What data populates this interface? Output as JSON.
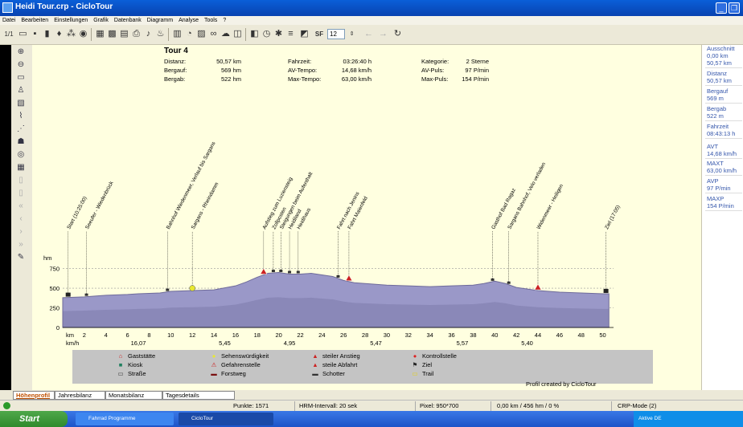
{
  "window": {
    "title": "Heidi Tour.crp - CicloTour"
  },
  "menu": [
    "Datei",
    "Bearbeiten",
    "Einstellungen",
    "Grafik",
    "Datenbank",
    "Diagramm",
    "Analyse",
    "Tools",
    "?"
  ],
  "toolbar": {
    "page_label": "1/1",
    "sf_label": "SF",
    "zoom_value": "12"
  },
  "tour": {
    "title": "Tour 4",
    "stats": [
      {
        "label": "Distanz:",
        "value": "50,57 km",
        "label2": "Fahrzeit:",
        "value2": "03:26:40 h",
        "label3": "Kategorie:",
        "value3": "2 Sterne"
      },
      {
        "label": "Bergauf:",
        "value": "569 hm",
        "label2": "AV-Tempo:",
        "value2": "14,68 km/h",
        "label3": "AV-Puls:",
        "value3": "97 P/min"
      },
      {
        "label": "Bergab:",
        "value": "522 hm",
        "label2": "Max-Tempo:",
        "value2": "63,00 km/h",
        "label3": "Max-Puls:",
        "value3": "154 P/min"
      }
    ]
  },
  "chart_data": {
    "type": "area",
    "title": "Tour 4",
    "ylabel": "hm",
    "x_speed_label": "km/h",
    "xlabel": "km",
    "ylim": [
      0,
      900
    ],
    "xlim": [
      0,
      51
    ],
    "y_ticks": [
      "0",
      "250",
      "500",
      "750"
    ],
    "x_ticks": [
      "2",
      "4",
      "6",
      "8",
      "10",
      "12",
      "14",
      "16",
      "18",
      "20",
      "22",
      "24",
      "26",
      "28",
      "30",
      "32",
      "34",
      "36",
      "38",
      "40",
      "42",
      "44",
      "46",
      "48",
      "50"
    ],
    "speed_labels": [
      {
        "km": 7,
        "text": "16,07"
      },
      {
        "km": 15,
        "text": "5,45"
      },
      {
        "km": 21,
        "text": "4,95"
      },
      {
        "km": 29,
        "text": "5,47"
      },
      {
        "km": 37,
        "text": "5,57"
      },
      {
        "km": 43,
        "text": "5,40"
      }
    ],
    "series": [
      {
        "values_x": [
          0,
          2,
          4,
          6,
          7,
          9,
          10,
          12,
          14,
          16,
          17,
          18,
          19,
          20,
          21,
          22,
          23,
          24,
          25,
          26,
          27,
          28,
          30,
          32,
          34,
          36,
          38,
          39,
          40,
          41,
          42,
          44,
          46,
          48,
          50,
          50.57
        ],
        "values_y": [
          380,
          390,
          410,
          420,
          430,
          440,
          460,
          470,
          480,
          530,
          580,
          640,
          690,
          700,
          680,
          680,
          690,
          670,
          650,
          600,
          570,
          560,
          540,
          530,
          520,
          530,
          540,
          560,
          590,
          560,
          510,
          470,
          450,
          440,
          430,
          430
        ]
      }
    ],
    "waypoints": [
      {
        "km": 0.5,
        "text": "Start (10:25:00)",
        "icon": "ziel"
      },
      {
        "km": 2.2,
        "text": "Seeufer - Wiedenbrück"
      },
      {
        "km": 9.7,
        "text": "Bahnhof Wiedenmeer, Verlauf bis Sargans"
      },
      {
        "km": 12.0,
        "text": "Sargans - Rheindamm",
        "icon": "sehens"
      },
      {
        "km": 18.6,
        "text": "Aufstieg zum Luziensteig",
        "icon": "anstieg"
      },
      {
        "km": 19.5,
        "text": "Zollposten"
      },
      {
        "km": 20.2,
        "text": "Steigungen beim Aufenthalt"
      },
      {
        "km": 21.0,
        "text": "Heidiland"
      },
      {
        "km": 21.8,
        "text": "Heidihaus"
      },
      {
        "km": 25.5,
        "text": "Fahrt nach Jenins"
      },
      {
        "km": 26.5,
        "text": "Fahrt Maienfeld",
        "icon": "anstieg"
      },
      {
        "km": 39.8,
        "text": "Gasthof Bad Ragaz"
      },
      {
        "km": 41.3,
        "text": "Sargans Bahnhof, Velo verladen"
      },
      {
        "km": 44.0,
        "text": "Widenmeer - Heiligen",
        "icon": "anstieg"
      },
      {
        "km": 50.3,
        "text": "Ziel (17:05)",
        "icon": "ziel"
      }
    ]
  },
  "legend": [
    {
      "icon": "gaststaette-icon",
      "glyph": "⌂",
      "color": "#cc2222",
      "label": "Gaststätte"
    },
    {
      "icon": "sehenswuerdigkeit-icon",
      "glyph": "●",
      "color": "#e8e830",
      "label": "Sehenswürdigkeit"
    },
    {
      "icon": "steiler-anstieg-icon",
      "glyph": "▲",
      "color": "#cc2222",
      "label": "steiler Anstieg"
    },
    {
      "icon": "kontrollstelle-icon",
      "glyph": "●",
      "color": "#dd2222",
      "label": "Kontrollstelle"
    },
    {
      "icon": "kiosk-icon",
      "glyph": "■",
      "color": "#208060",
      "label": "Kiosk"
    },
    {
      "icon": "gefahrenstelle-icon",
      "glyph": "⚠",
      "color": "#cc2222",
      "label": "Gefahrenstelle"
    },
    {
      "icon": "steile-abfahrt-icon",
      "glyph": "▲",
      "color": "#cc2222",
      "label": "steile Abfahrt"
    },
    {
      "icon": "ziel-icon",
      "glyph": "⚑",
      "color": "#222222",
      "label": "Ziel"
    },
    {
      "icon": "strasse-icon",
      "glyph": "▭",
      "color": "#444444",
      "label": "Straße"
    },
    {
      "icon": "forstweg-icon",
      "glyph": "▬",
      "color": "#7a1010",
      "label": "Forstweg"
    },
    {
      "icon": "schotter-icon",
      "glyph": "▬",
      "color": "#333333",
      "label": "Schotter"
    },
    {
      "icon": "trail-icon",
      "glyph": "▭",
      "color": "#e0d020",
      "label": "Trail"
    }
  ],
  "credit": "Profil created by CicloTour",
  "right_panel": [
    {
      "label": "Ausschnitt",
      "value": "0,00 km",
      "value2": "50,57 km"
    },
    {
      "label": "Distanz",
      "value": "50,57 km"
    },
    {
      "label": "Bergauf",
      "value": "569 m"
    },
    {
      "label": "Bergab",
      "value": "522 m"
    },
    {
      "label": "Fahrzeit",
      "value": "08:43:13 h"
    },
    {
      "label": "AVT",
      "value": "14,68 km/h"
    },
    {
      "label": "MAXT",
      "value": "63,00 km/h"
    },
    {
      "label": "AVP",
      "value": "97 P/min"
    },
    {
      "label": "MAXP",
      "value": "154 P/min"
    }
  ],
  "tabs": [
    "Höhenprofil",
    "Jahresbilanz",
    "Monatsbilanz",
    "Tagesdetails"
  ],
  "status": {
    "punkte": "Punkte: 1571",
    "hrm": "HRM-Intervall: 20 sek",
    "pixel": "Pixel: 950*700",
    "distance": "0,00 km / 456 hm / 0 %",
    "mode": "CRP-Mode (2)"
  },
  "taskbar": {
    "start": "Start",
    "tasks": [
      "Fahrrad Programme",
      "CicloTour"
    ],
    "tray": "Aktive   DE"
  },
  "colors": {
    "profile_fill": "#9a98c8",
    "profile_dark": "#6e6a9a",
    "title_bar": "#0a5fd8",
    "chart_bg": "#ffffe0"
  }
}
